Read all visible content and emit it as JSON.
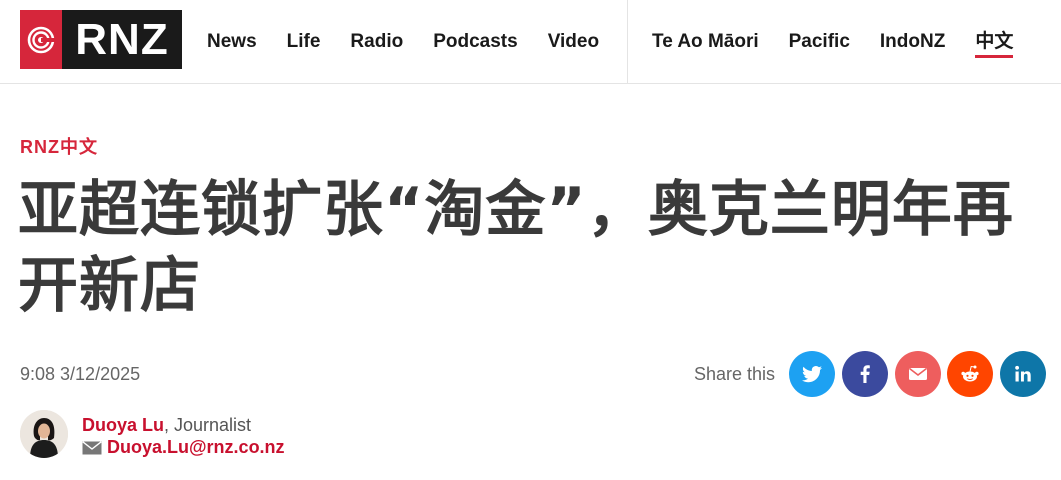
{
  "brand": {
    "logo_text": "RNZ",
    "logo_color": "#d6263b"
  },
  "nav": {
    "primary": [
      {
        "label": "News"
      },
      {
        "label": "Life"
      },
      {
        "label": "Radio"
      },
      {
        "label": "Podcasts"
      },
      {
        "label": "Video"
      }
    ],
    "secondary": [
      {
        "label": "Te Ao Māori"
      },
      {
        "label": "Pacific"
      },
      {
        "label": "IndoNZ"
      },
      {
        "label": "中文",
        "active": true
      }
    ]
  },
  "article": {
    "section": "RNZ中文",
    "headline": "亚超连锁扩张“淘金”，奥克兰明年再开新店",
    "timestamp": "9:08 3/12/2025",
    "share_label": "Share this",
    "share_buttons": [
      {
        "name": "twitter",
        "icon": "twitter-icon",
        "color": "#1da1f2"
      },
      {
        "name": "facebook",
        "icon": "facebook-icon",
        "color": "#3b4a9e"
      },
      {
        "name": "email",
        "icon": "envelope-icon",
        "color": "#ee5e5e"
      },
      {
        "name": "reddit",
        "icon": "reddit-icon",
        "color": "#ff4500"
      },
      {
        "name": "linkedin",
        "icon": "linkedin-icon",
        "color": "#0e76a8"
      }
    ],
    "author": {
      "name": "Duoya Lu",
      "role": ", Journalist",
      "email": "Duoya.Lu@rnz.co.nz"
    }
  }
}
